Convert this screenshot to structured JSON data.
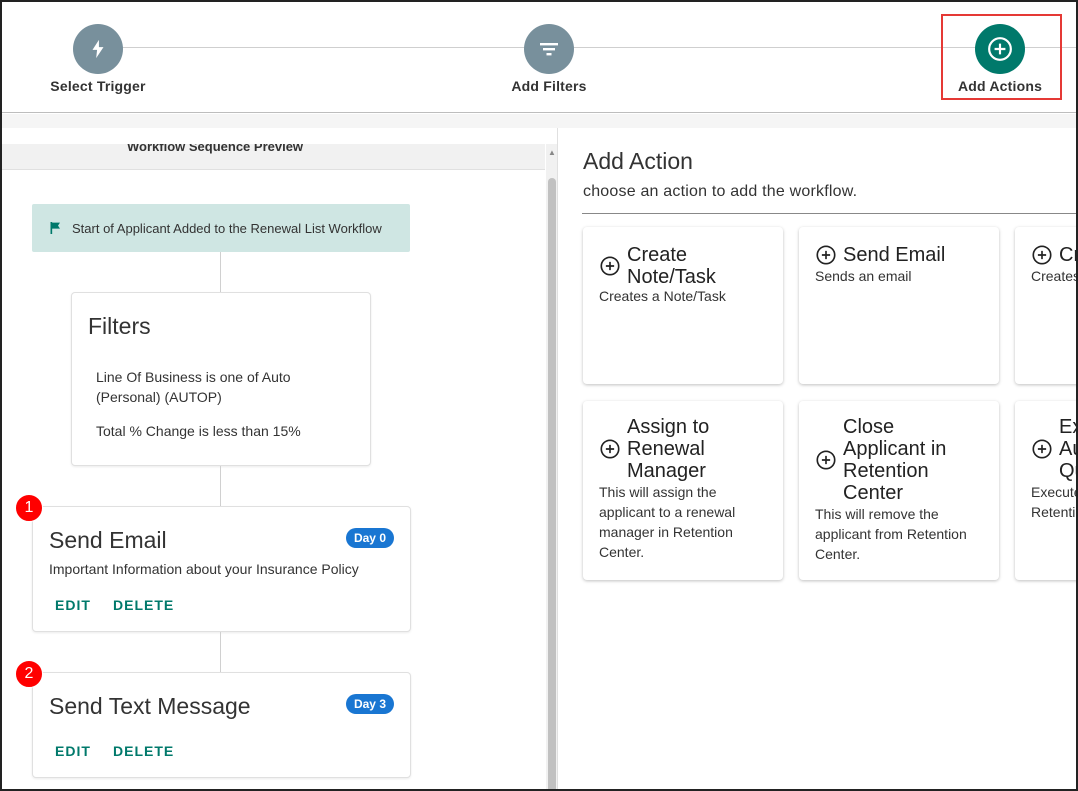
{
  "stepper": {
    "steps": [
      {
        "label": "Select Trigger",
        "icon": "bolt-icon",
        "color": "#78909c"
      },
      {
        "label": "Add Filters",
        "icon": "filter-icon",
        "color": "#78909c"
      },
      {
        "label": "Add Actions",
        "icon": "add-circle-icon",
        "color": "#00796b"
      }
    ]
  },
  "preview": {
    "header": "Workflow Sequence Preview",
    "start_label": "Start of Applicant Added to the Renewal List Workflow",
    "filters": {
      "title": "Filters",
      "items": [
        "Line Of Business is one of Auto (Personal) (AUTOP)",
        "Total % Change is less than 15%"
      ]
    },
    "actions": [
      {
        "number": "1",
        "title": "Send Email",
        "day": "Day 0",
        "description": "Important Information about your Insurance Policy",
        "edit": "EDIT",
        "delete": "DELETE"
      },
      {
        "number": "2",
        "title": "Send Text Message",
        "day": "Day 3",
        "description": "",
        "edit": "EDIT",
        "delete": "DELETE"
      }
    ]
  },
  "add_action": {
    "title": "Add Action",
    "subtitle": "choose an action to add the workflow.",
    "options": [
      {
        "title": "Create Note/Task",
        "description": "Creates a Note/Task"
      },
      {
        "title": "Send Email",
        "description": "Sends an email"
      },
      {
        "title": "Cr",
        "description": "Creates"
      },
      {
        "title": "Assign to Renewal Manager",
        "description": "This will assign the applicant to a renewal manager in Retention Center."
      },
      {
        "title": "Close Applicant in Retention Center",
        "description": "This will remove the applicant from Retention Center."
      },
      {
        "title": "Ex Au Qu",
        "description": "Execute Retentio"
      }
    ]
  },
  "colors": {
    "accent": "#00796b",
    "badge_blue": "#1976d2",
    "badge_red": "#ff0000",
    "start_bg": "#cfe6e3",
    "highlight": "#e53935"
  }
}
